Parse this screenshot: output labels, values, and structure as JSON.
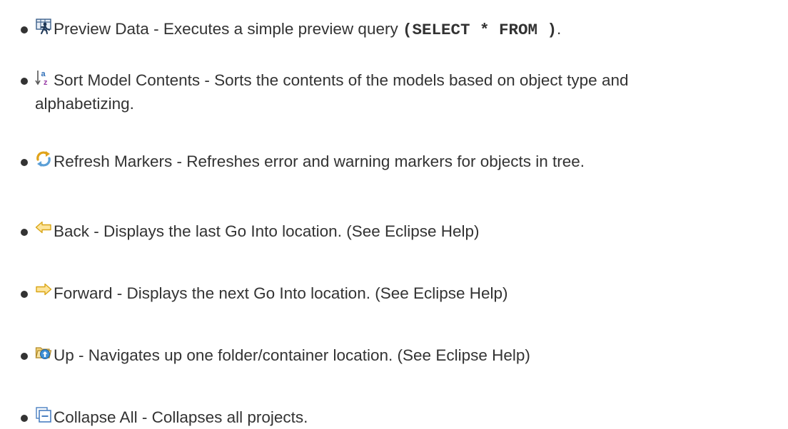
{
  "items": [
    {
      "icon": "preview-data-icon",
      "name": "Preview Data",
      "sep": " - ",
      "description": "Executes a simple preview query ",
      "code": "(SELECT * FROM )",
      "suffix": "."
    },
    {
      "icon": "sort-az-icon",
      "name": "Sort Model Contents",
      "sep": " - ",
      "description_line1": "Sorts the contents of the models based on object type and",
      "description_line2": "alphabetizing."
    },
    {
      "icon": "refresh-markers-icon",
      "name": "Refresh Markers",
      "sep": " - ",
      "description": "Refreshes error and warning markers for objects in tree."
    },
    {
      "icon": "back-arrow-icon",
      "name": "Back",
      "sep": " - ",
      "description": "Displays the last Go Into location. (See Eclipse Help)"
    },
    {
      "icon": "forward-arrow-icon",
      "name": "Forward",
      "sep": " - ",
      "description": "Displays the next Go Into location. (See Eclipse Help)"
    },
    {
      "icon": "up-folder-icon",
      "name": "Up",
      "sep": " - ",
      "description": "Navigates up one folder/container location. (See Eclipse Help)"
    },
    {
      "icon": "collapse-all-icon",
      "name": "Collapse All",
      "sep": " - ",
      "description": "Collapses all projects."
    }
  ],
  "colors": {
    "text": "#333333",
    "arrow_fill": "#fde49b",
    "arrow_stroke": "#d9a516",
    "collapse_blue": "#4a7fc1"
  }
}
